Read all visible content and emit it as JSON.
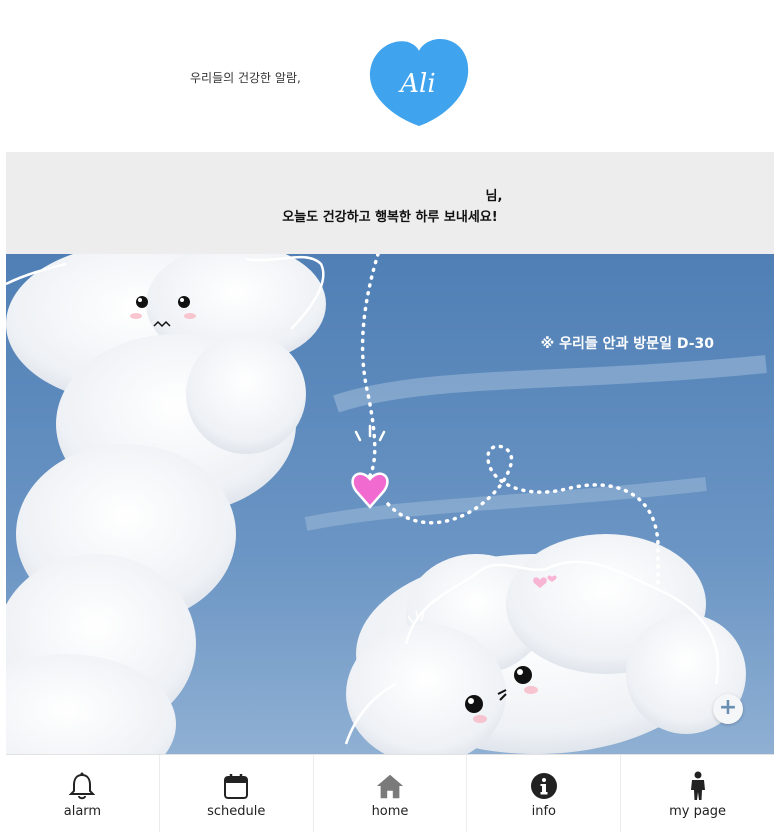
{
  "header": {
    "tagline": "우리들의 건강한 알람,",
    "logo_text": "Ali",
    "logo_color": "#3fa3ee"
  },
  "greeting": {
    "name_suffix": "님,",
    "message": "오늘도 건강하고 행복한 하루 보내세요!"
  },
  "hero": {
    "dday_text": "※ 우리들 안과 방문일 D-30",
    "add_label": "+",
    "sky_color": "#5a86b8",
    "heart_color": "#f06ad0"
  },
  "nav": {
    "items": [
      {
        "label": "alarm",
        "icon": "bell-icon"
      },
      {
        "label": "schedule",
        "icon": "calendar-icon"
      },
      {
        "label": "home",
        "icon": "home-icon"
      },
      {
        "label": "info",
        "icon": "info-icon"
      },
      {
        "label": "my page",
        "icon": "person-icon"
      }
    ]
  }
}
